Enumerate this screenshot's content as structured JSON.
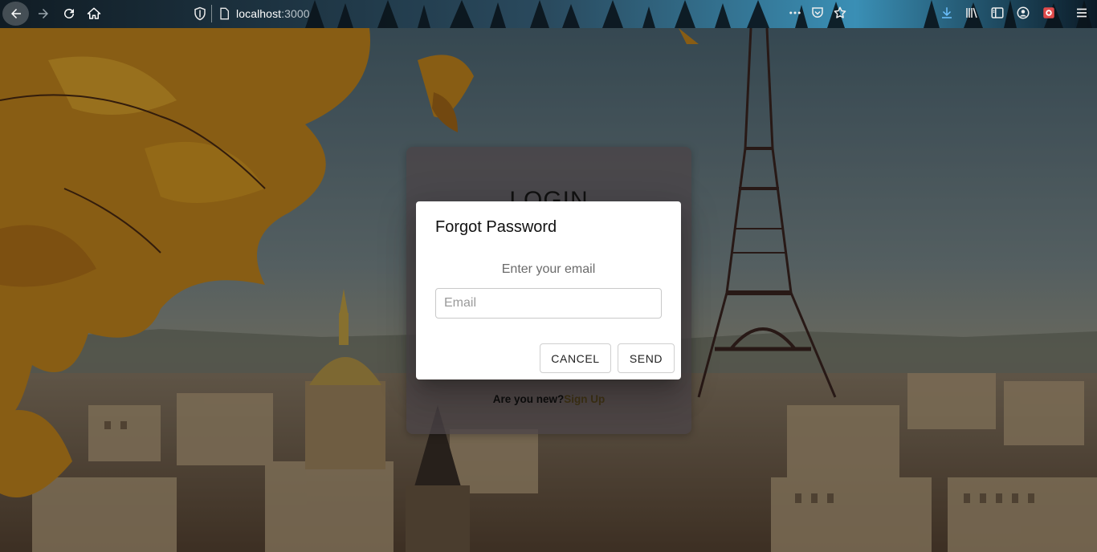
{
  "browser": {
    "url_host": "localhost",
    "url_port": ":3000"
  },
  "login": {
    "title": "LOGIN",
    "signup_prompt": "Are you new?",
    "signup_link": "Sign Up"
  },
  "dialog": {
    "title": "Forgot Password",
    "text": "Enter your email",
    "email_placeholder": "Email",
    "email_value": "",
    "cancel_label": "CANCEL",
    "send_label": "SEND"
  }
}
